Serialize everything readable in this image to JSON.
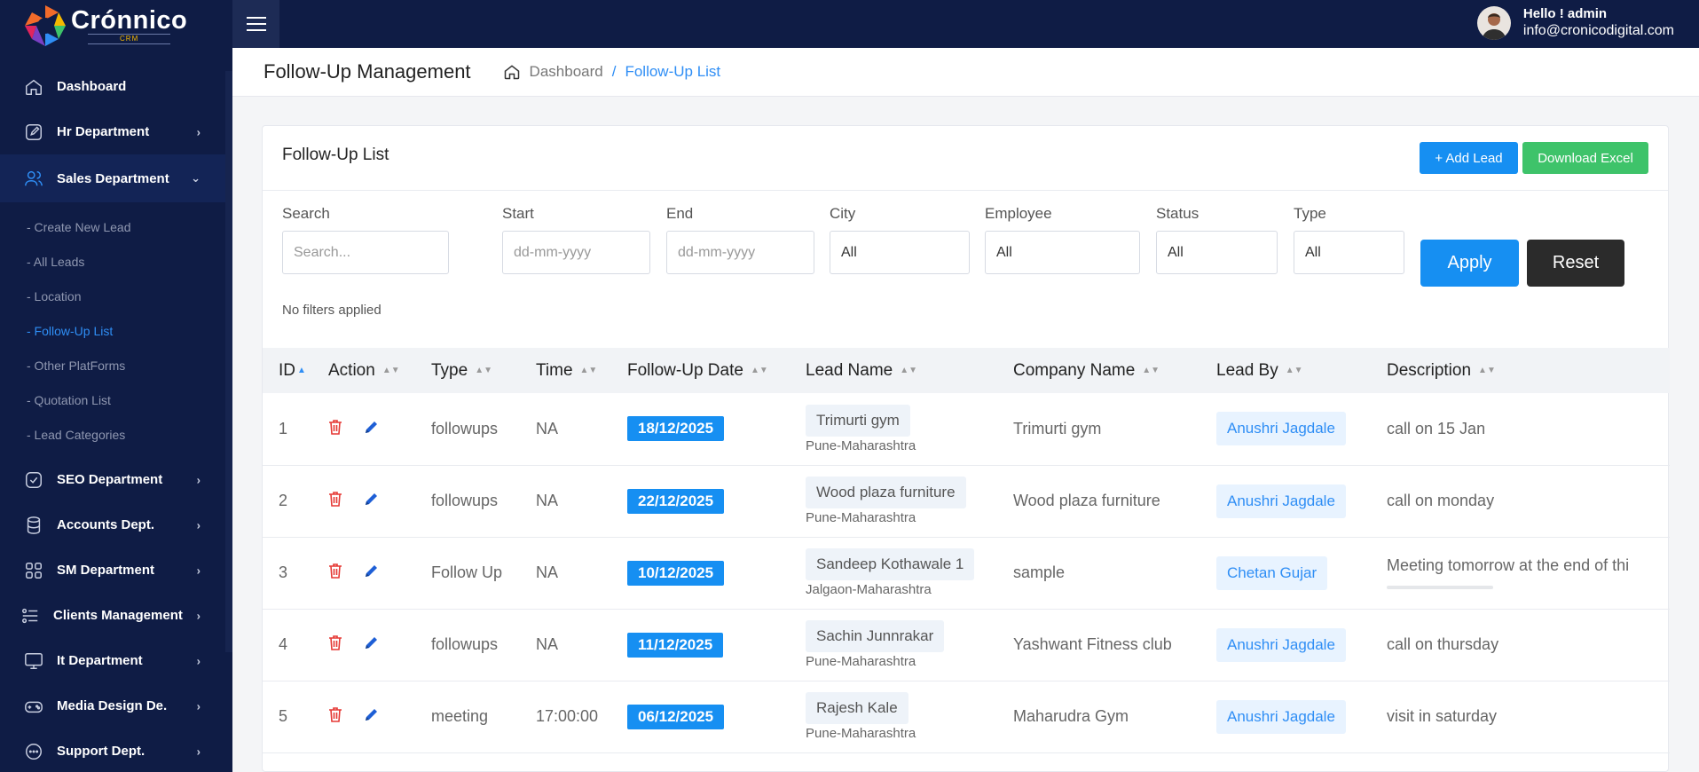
{
  "brand": {
    "name": "Crónnico",
    "sub": "CRM"
  },
  "topbar": {
    "hello": "Hello ! admin",
    "email": "info@cronicodigital.com"
  },
  "sidebar": {
    "items": [
      {
        "label": "Dashboard",
        "icon": "home-icon"
      },
      {
        "label": "Hr Department",
        "icon": "edit-icon"
      },
      {
        "label": "Sales Department",
        "icon": "users-icon"
      },
      {
        "label": "SEO Department",
        "icon": "check-square-icon"
      },
      {
        "label": "Accounts Dept.",
        "icon": "database-icon"
      },
      {
        "label": "SM Department",
        "icon": "grid-icon"
      },
      {
        "label": "Clients Management",
        "icon": "list-icon"
      },
      {
        "label": "It Department",
        "icon": "monitor-icon"
      },
      {
        "label": "Media Design De.",
        "icon": "gamepad-icon"
      },
      {
        "label": "Support Dept.",
        "icon": "chat-icon"
      }
    ],
    "sales_sub": [
      "- Create New Lead",
      "- All Leads",
      "- Location",
      "- Follow-Up List",
      "- Other PlatForms",
      "- Quotation List",
      "- Lead Categories"
    ]
  },
  "header": {
    "title": "Follow-Up Management",
    "crumb_home": "Dashboard",
    "crumb_sep": "/",
    "crumb_current": "Follow-Up List"
  },
  "card": {
    "title": "Follow-Up List",
    "add_label": "+ Add Lead",
    "excel_label": "Download Excel"
  },
  "filters": {
    "search_label": "Search",
    "search_placeholder": "Search...",
    "start_label": "Start",
    "start_placeholder": "dd-mm-yyyy",
    "end_label": "End",
    "end_placeholder": "dd-mm-yyyy",
    "city_label": "City",
    "city_value": "All",
    "employee_label": "Employee",
    "employee_value": "All",
    "status_label": "Status",
    "status_value": "All",
    "type_label": "Type",
    "type_value": "All",
    "apply_label": "Apply",
    "reset_label": "Reset",
    "no_filters": "No filters applied"
  },
  "table": {
    "columns": [
      "ID",
      "Action",
      "Type",
      "Time",
      "Follow-Up Date",
      "Lead Name",
      "Company Name",
      "Lead By",
      "Description"
    ],
    "rows": [
      {
        "id": "1",
        "type": "followups",
        "time": "NA",
        "date": "18/12/2025",
        "lead": "Trimurti gym",
        "loc": "Pune-Maharashtra",
        "company": "Trimurti gym",
        "by": "Anushri Jagdale",
        "desc": "call on 15 Jan"
      },
      {
        "id": "2",
        "type": "followups",
        "time": "NA",
        "date": "22/12/2025",
        "lead": "Wood plaza furniture",
        "loc": "Pune-Maharashtra",
        "company": "Wood plaza furniture",
        "by": "Anushri Jagdale",
        "desc": "call on monday"
      },
      {
        "id": "3",
        "type": "Follow Up",
        "time": "NA",
        "date": "10/12/2025",
        "lead": "Sandeep Kothawale 1",
        "loc": "Jalgaon-Maharashtra",
        "company": "sample",
        "by": "Chetan Gujar",
        "desc": "Meeting tomorrow at the end of thi"
      },
      {
        "id": "4",
        "type": "followups",
        "time": "NA",
        "date": "11/12/2025",
        "lead": "Sachin Junnrakar",
        "loc": "Pune-Maharashtra",
        "company": "Yashwant Fitness club",
        "by": "Anushri Jagdale",
        "desc": "call on thursday"
      },
      {
        "id": "5",
        "type": "meeting",
        "time": "17:00:00",
        "date": "06/12/2025",
        "lead": "Rajesh Kale",
        "loc": "Pune-Maharashtra",
        "company": "Maharudra Gym",
        "by": "Anushri Jagdale",
        "desc": "visit in saturday"
      }
    ]
  }
}
